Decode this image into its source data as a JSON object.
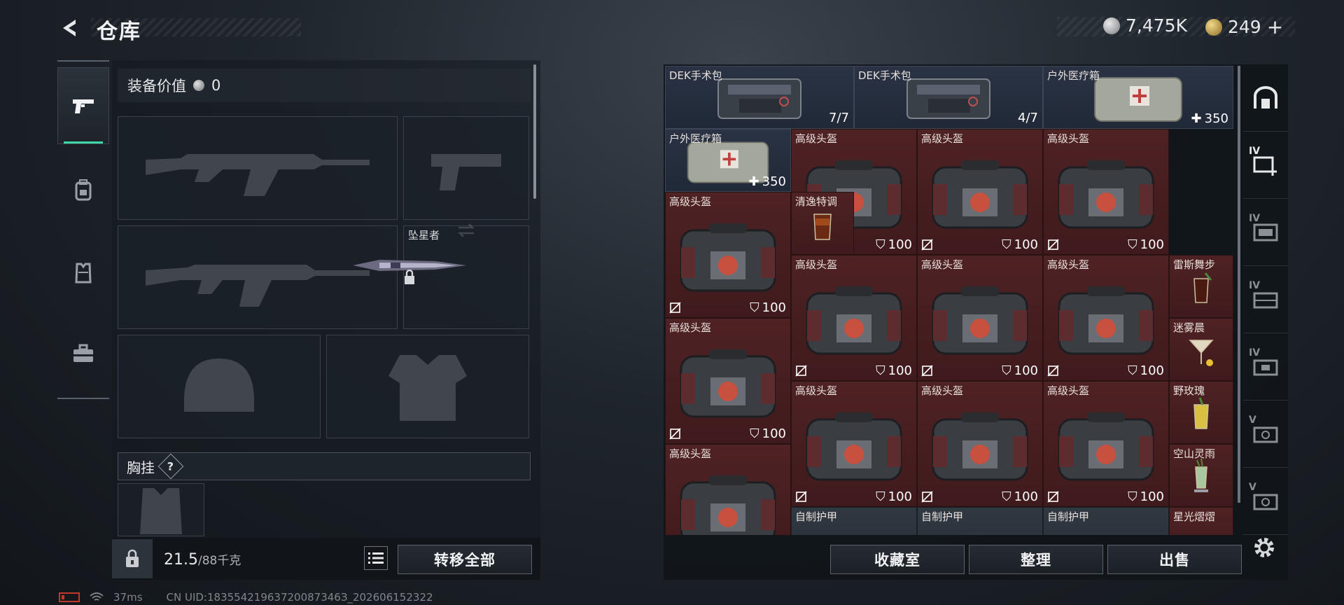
{
  "header": {
    "title": "仓库",
    "silver_amount": "7,475K",
    "gold_amount": "249",
    "gold_plus": "+"
  },
  "left_rail": {
    "items": [
      {
        "icon": "pistol-icon",
        "active": true
      },
      {
        "icon": "backpack-icon",
        "active": false
      },
      {
        "icon": "vest-icon",
        "active": false
      },
      {
        "icon": "toolbox-icon",
        "active": false
      }
    ]
  },
  "equipment": {
    "value_label": "装备价值",
    "value": "0",
    "melee_name": "坠星者",
    "vest_label": "胸挂",
    "vest_help": "?"
  },
  "footer_left": {
    "weight_current": "21.5",
    "weight_max": "/88千克",
    "transfer_all": "转移全部"
  },
  "footer_right": {
    "collection": "收藏室",
    "organize": "整理",
    "sell": "出售"
  },
  "status": {
    "ping": "37ms",
    "uid": "CN UID:18355421963720087346З_202606152322"
  },
  "grid_items": [
    {
      "name": "DEK手术包",
      "count": "7/7"
    },
    {
      "name": "DEK手术包",
      "count": "4/7"
    },
    {
      "name": "户外医疗箱",
      "value": "350"
    },
    {
      "name": "户外医疗箱",
      "value": "350"
    },
    {
      "name": "高级头盔",
      "value": "100"
    },
    {
      "name": "清逸特调"
    },
    {
      "name": "雷斯舞步"
    },
    {
      "name": "迷雾晨"
    },
    {
      "name": "野玫瑰"
    },
    {
      "name": "空山灵雨"
    },
    {
      "name": "自制护甲"
    },
    {
      "name": "星光熠熠"
    }
  ],
  "right_rail": {
    "items": [
      {
        "tier": "",
        "icon": "safe-box-icon"
      },
      {
        "tier": "IV",
        "icon": "add-storage-icon"
      },
      {
        "tier": "IV",
        "icon": "storage-1-icon"
      },
      {
        "tier": "IV",
        "icon": "storage-2-icon"
      },
      {
        "tier": "IV",
        "icon": "storage-3-icon"
      },
      {
        "tier": "V",
        "icon": "storage-4-icon"
      },
      {
        "tier": "V",
        "icon": "storage-5-icon"
      }
    ],
    "settings_icon": "gear-icon"
  },
  "colors": {
    "accent": "#3fd7a8",
    "red_cell": "#4a1f21",
    "blue_cell": "#262f3f"
  }
}
